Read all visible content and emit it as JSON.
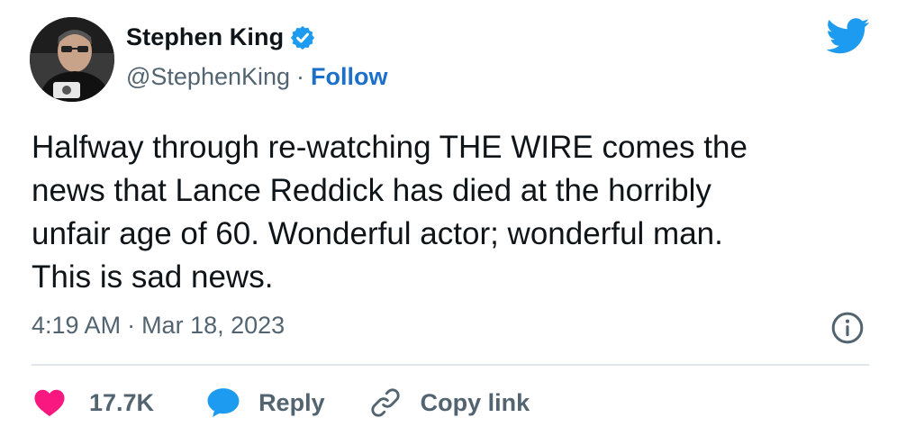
{
  "author": {
    "name": "Stephen King",
    "handle": "@StephenKing",
    "separator": "·",
    "follow_label": "Follow"
  },
  "icons": {
    "verified": "verified-badge-icon",
    "platform": "twitter-bird-icon",
    "info": "info-icon",
    "like": "heart-icon",
    "reply": "speech-bubble-icon",
    "copy_link": "link-icon"
  },
  "colors": {
    "brand_blue": "#1d9bf0",
    "follow_blue": "#1d70c9",
    "like_pink": "#f91880",
    "secondary_text": "#536471"
  },
  "tweet": {
    "text": "Halfway through re-watching THE WIRE comes the\nnews that Lance Reddick has died at the horribly\nunfair age of 60. Wonderful actor; wonderful man.\nThis is sad news.",
    "time": "4:19 AM",
    "separator": "·",
    "date": "Mar 18, 2023"
  },
  "actions": {
    "likes": "17.7K",
    "reply_label": "Reply",
    "copy_link_label": "Copy link"
  }
}
